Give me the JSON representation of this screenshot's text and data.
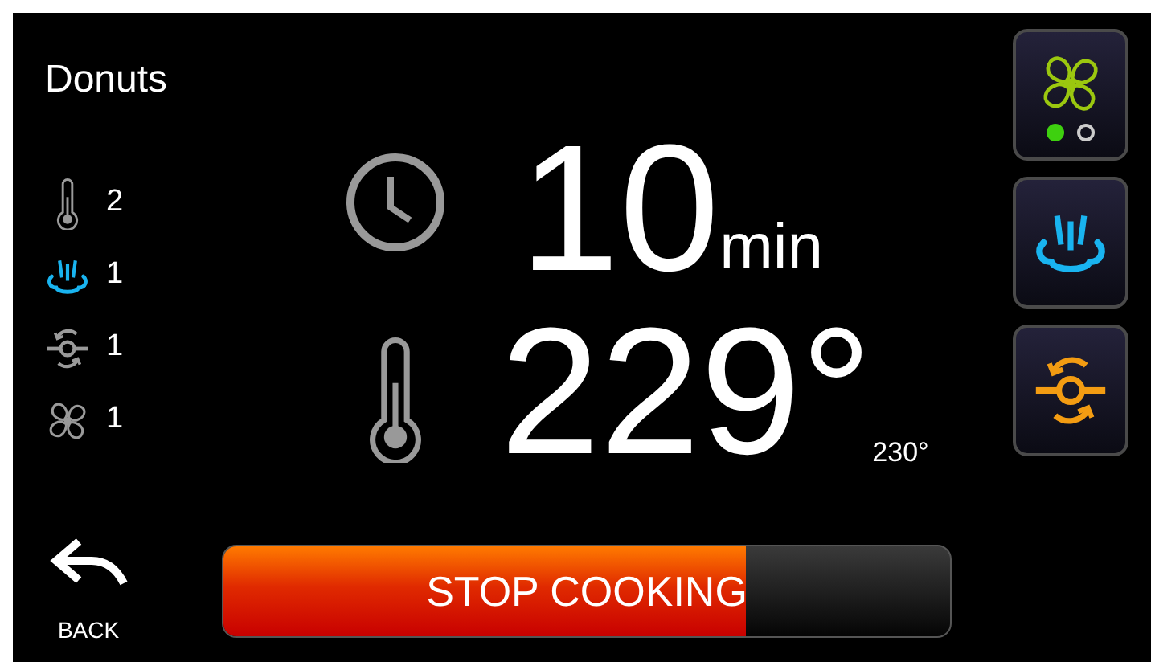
{
  "recipe": {
    "title": "Donuts"
  },
  "stats": [
    {
      "kind": "temperature",
      "value": "2",
      "active": false
    },
    {
      "kind": "steam",
      "value": "1",
      "active": true
    },
    {
      "kind": "damper",
      "value": "1",
      "active": false
    },
    {
      "kind": "fan",
      "value": "1",
      "active": false
    }
  ],
  "time": {
    "value": "10",
    "unit": "min"
  },
  "temperature": {
    "value": "229°",
    "target": "230°"
  },
  "mode_buttons": [
    {
      "kind": "fan",
      "indicators": [
        {
          "selected": true
        },
        {
          "selected": false
        }
      ]
    },
    {
      "kind": "steam"
    },
    {
      "kind": "damper"
    }
  ],
  "back": {
    "label": "BACK"
  },
  "stop": {
    "label": "STOP COOKING",
    "level": 0.72
  }
}
